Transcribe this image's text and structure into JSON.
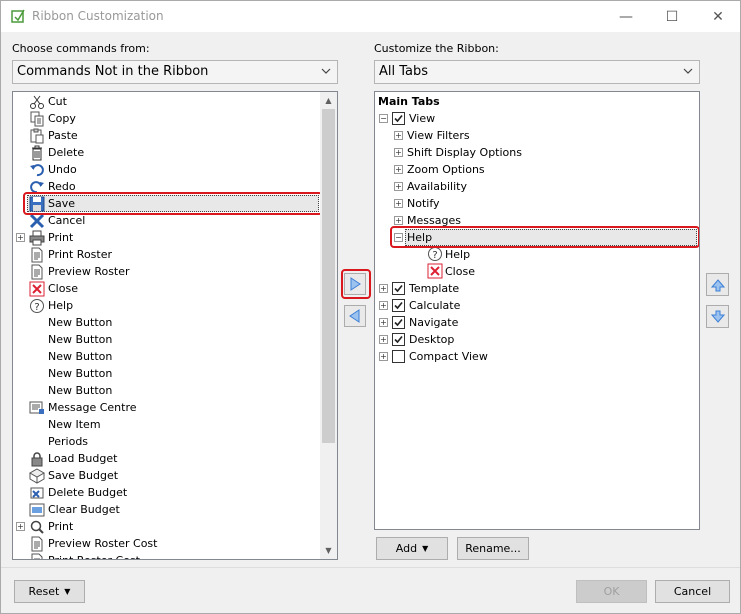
{
  "window": {
    "title": "Ribbon Customization",
    "minimize": "—",
    "maximize": "☐",
    "close": "✕"
  },
  "left": {
    "label": "Choose commands from:",
    "combo_value": "Commands Not in the Ribbon",
    "items": [
      {
        "label": "Cut",
        "icon": "scissors-icon",
        "expander": false
      },
      {
        "label": "Copy",
        "icon": "copy-icon",
        "expander": false
      },
      {
        "label": "Paste",
        "icon": "paste-icon",
        "expander": false
      },
      {
        "label": "Delete",
        "icon": "trash-icon",
        "expander": false
      },
      {
        "label": "Undo",
        "icon": "undo-icon",
        "expander": false
      },
      {
        "label": "Redo",
        "icon": "redo-icon",
        "expander": false
      },
      {
        "label": "Save",
        "icon": "save-icon",
        "expander": false
      },
      {
        "label": "Cancel",
        "icon": "cancel-x-icon",
        "expander": false
      },
      {
        "label": "Print",
        "icon": "printer-icon",
        "expander": true
      },
      {
        "label": "Print Roster",
        "icon": "document-icon",
        "expander": false
      },
      {
        "label": "Preview Roster",
        "icon": "document-icon",
        "expander": false
      },
      {
        "label": "Close",
        "icon": "close-red-icon",
        "expander": false
      },
      {
        "label": "Help",
        "icon": "help-icon",
        "expander": false
      },
      {
        "label": "New Button",
        "icon": "",
        "expander": false
      },
      {
        "label": "New Button",
        "icon": "",
        "expander": false
      },
      {
        "label": "New Button",
        "icon": "",
        "expander": false
      },
      {
        "label": "New Button",
        "icon": "",
        "expander": false
      },
      {
        "label": "New Button",
        "icon": "",
        "expander": false
      },
      {
        "label": "Message Centre",
        "icon": "message-icon",
        "expander": false
      },
      {
        "label": "New Item",
        "icon": "",
        "expander": false
      },
      {
        "label": "Periods",
        "icon": "",
        "expander": false
      },
      {
        "label": "Load Budget",
        "icon": "lock-icon",
        "expander": false
      },
      {
        "label": "Save Budget",
        "icon": "save-budget-icon",
        "expander": false
      },
      {
        "label": "Delete Budget",
        "icon": "delete-budget-icon",
        "expander": false
      },
      {
        "label": "Clear Budget",
        "icon": "clear-budget-icon",
        "expander": false
      },
      {
        "label": "Print",
        "icon": "magnifier-icon",
        "expander": true
      },
      {
        "label": "Preview Roster Cost",
        "icon": "document-icon",
        "expander": false
      },
      {
        "label": "Print Roster Cost",
        "icon": "document-icon",
        "expander": false
      }
    ]
  },
  "right": {
    "label": "Customize the Ribbon:",
    "combo_value": "All Tabs",
    "header": "Main Tabs",
    "tree": [
      {
        "label": "View",
        "level": 0,
        "expander": "−",
        "checkbox": true,
        "checked": true
      },
      {
        "label": "View Filters",
        "level": 1,
        "expander": "+",
        "checkbox": false
      },
      {
        "label": "Shift Display Options",
        "level": 1,
        "expander": "+",
        "checkbox": false
      },
      {
        "label": "Zoom Options",
        "level": 1,
        "expander": "+",
        "checkbox": false
      },
      {
        "label": "Availability",
        "level": 1,
        "expander": "+",
        "checkbox": false
      },
      {
        "label": "Notify",
        "level": 1,
        "expander": "+",
        "checkbox": false
      },
      {
        "label": "Messages",
        "level": 1,
        "expander": "+",
        "checkbox": false
      },
      {
        "label": "Help",
        "level": 1,
        "expander": "−",
        "checkbox": false
      },
      {
        "label": "Help",
        "level": 2,
        "expander": "",
        "checkbox": false,
        "icon": "help-icon"
      },
      {
        "label": "Close",
        "level": 2,
        "expander": "",
        "checkbox": false,
        "icon": "close-red-icon"
      },
      {
        "label": "Template",
        "level": 0,
        "expander": "+",
        "checkbox": true,
        "checked": true
      },
      {
        "label": "Calculate",
        "level": 0,
        "expander": "+",
        "checkbox": true,
        "checked": true
      },
      {
        "label": "Navigate",
        "level": 0,
        "expander": "+",
        "checkbox": true,
        "checked": true
      },
      {
        "label": "Desktop",
        "level": 0,
        "expander": "+",
        "checkbox": true,
        "checked": true
      },
      {
        "label": "Compact View",
        "level": 0,
        "expander": "+",
        "checkbox": true,
        "checked": false
      }
    ]
  },
  "buttons": {
    "add": "Add",
    "rename": "Rename...",
    "reset": "Reset",
    "ok": "OK",
    "cancel": "Cancel"
  },
  "colors": {
    "highlight": "#d9181e",
    "arrow_blue": "#3c7fd6"
  }
}
